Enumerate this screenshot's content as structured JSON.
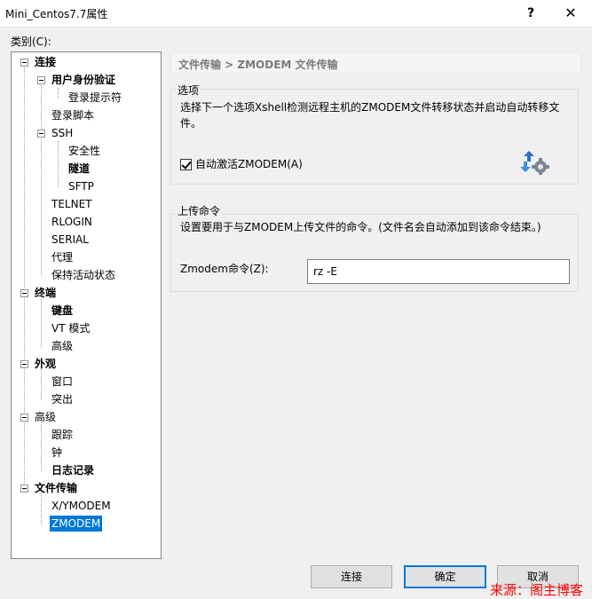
{
  "window": {
    "title": "Mini_Centos7.7属性",
    "help_label": "?",
    "close_label": "✕"
  },
  "category_label": "类别(C):",
  "tree": {
    "connection": "连接",
    "auth": "用户身份验证",
    "login_prompt": "登录提示符",
    "login_script": "登录脚本",
    "ssh": "SSH",
    "security": "安全性",
    "tunnel": "隧道",
    "sftp": "SFTP",
    "telnet": "TELNET",
    "rlogin": "RLOGIN",
    "serial": "SERIAL",
    "proxy": "代理",
    "keepalive": "保持活动状态",
    "terminal": "终端",
    "keyboard": "键盘",
    "vt_mode": "VT 模式",
    "advanced1": "高级",
    "appearance": "外观",
    "window": "窗口",
    "highlight": "突出",
    "advanced2": "高级",
    "trace": "跟踪",
    "bell": "钟",
    "logging": "日志记录",
    "file_transfer": "文件传输",
    "xymodem": "X/YMODEM",
    "zmodem": "ZMODEM"
  },
  "panel": {
    "breadcrumb": "文件传输 > ZMODEM 文件传输",
    "options_title": "选项",
    "options_desc_line1": "选择下一个选项Xshell检测远程主机的ZMODEM文件转移状态并启动自动转移文",
    "options_desc_line2": "件。",
    "auto_activate_label": "自动激活ZMODEM(A)",
    "auto_activate_checked": true,
    "upload_title": "上传命令",
    "upload_desc": "设置要用于与ZMODEM上传文件的命令。(文件名会自动添加到该命令结束。)",
    "zmodem_cmd_label": "Zmodem命令(Z):",
    "zmodem_cmd_value": "rz -E"
  },
  "buttons": {
    "connect": "连接",
    "ok": "确定",
    "cancel": "取消"
  },
  "watermark": "来源：阁主博客",
  "colors": {
    "selection": "#0078d7",
    "default_button_border": "#0078d7",
    "watermark": "#ff0000"
  }
}
